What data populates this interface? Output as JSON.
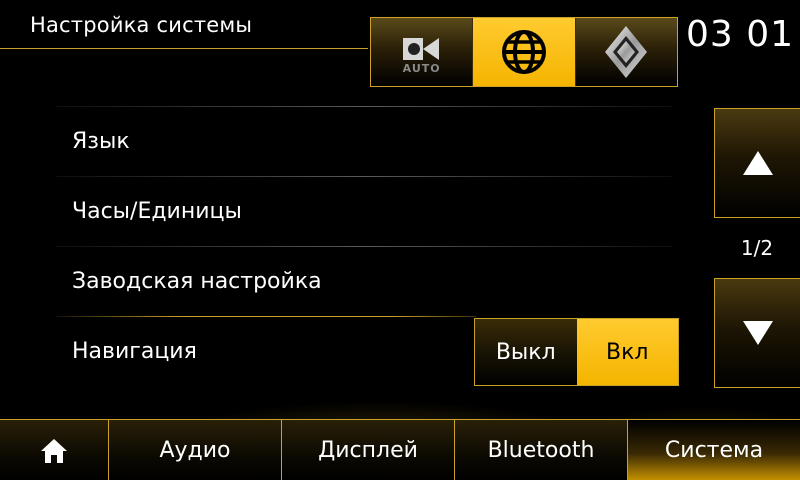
{
  "header": {
    "title": "Настройка системы",
    "clock": "03 01",
    "mode_buttons": [
      {
        "name": "video-auto",
        "icon": "video-camera-auto-icon",
        "label": "AUTO",
        "active": false
      },
      {
        "name": "globe",
        "icon": "globe-icon",
        "active": true
      },
      {
        "name": "brand",
        "icon": "renault-logo-icon",
        "active": false
      }
    ]
  },
  "menu": {
    "items": [
      {
        "label": "Язык"
      },
      {
        "label": "Часы/Единицы"
      },
      {
        "label": "Заводская настройка"
      },
      {
        "label": "Навигация"
      }
    ],
    "navigation_toggle": {
      "off_label": "Выкл",
      "on_label": "Вкл",
      "selected": "Вкл"
    }
  },
  "scroll": {
    "page_indicator": "1/2",
    "up_icon": "triangle-up-icon",
    "down_icon": "triangle-down-icon"
  },
  "bottom_nav": {
    "tabs": [
      {
        "label": "",
        "icon": "home-icon"
      },
      {
        "label": "Аудио"
      },
      {
        "label": "Дисплей"
      },
      {
        "label": "Bluetooth"
      },
      {
        "label": "Система",
        "active": true
      }
    ]
  },
  "colors": {
    "accent": "#f5b400",
    "border_gold": "#c9a227",
    "background": "#000000"
  }
}
